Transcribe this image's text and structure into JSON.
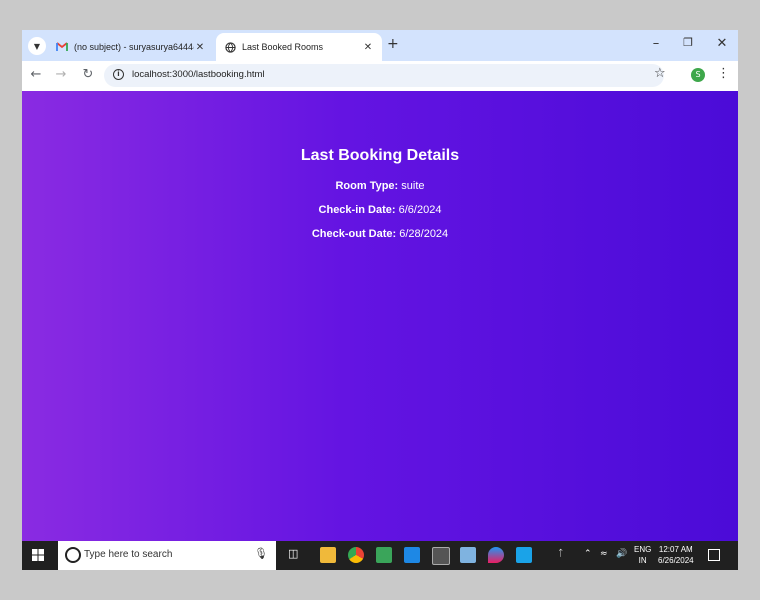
{
  "browser": {
    "tabs": [
      {
        "label": "(no subject) - suryasurya6444@",
        "favicon": "gmail-icon",
        "active": false
      },
      {
        "label": "Last Booked Rooms",
        "favicon": "globe-icon",
        "active": true
      }
    ],
    "url": "localhost:3000/lastbooking.html",
    "profile_initial": "S"
  },
  "page": {
    "heading": "Last Booking Details",
    "room_type_label": "Room Type:",
    "room_type_value": "suite",
    "checkin_label": "Check-in Date:",
    "checkin_value": "6/6/2024",
    "checkout_label": "Check-out Date:",
    "checkout_value": "6/28/2024"
  },
  "taskbar": {
    "search_placeholder": "Type here to search",
    "lang_top": "ENG",
    "lang_bottom": "IN",
    "time": "12:07 AM",
    "date": "6/26/2024"
  },
  "colors": {
    "gradient_start": "#8a2be2",
    "gradient_end": "#4b0bd8",
    "tabstrip": "#d3e3fd",
    "taskbar": "#202020"
  }
}
